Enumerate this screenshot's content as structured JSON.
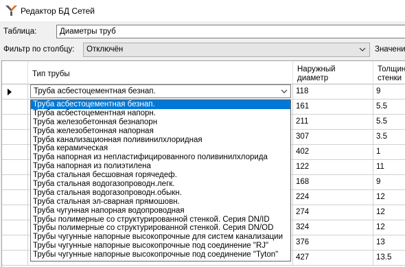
{
  "window": {
    "title": "Редактор БД Сетей"
  },
  "form": {
    "table_label": "Таблица:",
    "table_value": "Диаметры труб",
    "filter_label": "Фильтр по столбцу:",
    "filter_value": "Отключён",
    "value_label": "Значени"
  },
  "grid": {
    "headers": {
      "pipe_type": "Тип трубы",
      "outer_diameter": "Наружный диаметр",
      "wall_line1": "Толщин",
      "wall_line2": "стенки"
    },
    "current_row_combo": "Труба асбестоцементная безнап.",
    "rows": [
      {
        "diameter": "118",
        "wall": "9"
      },
      {
        "diameter": "161",
        "wall": "5.5"
      },
      {
        "diameter": "211",
        "wall": "5.5"
      },
      {
        "diameter": "307",
        "wall": "3.5"
      },
      {
        "diameter": "402",
        "wall": "1"
      },
      {
        "diameter": "122",
        "wall": "11"
      },
      {
        "diameter": "168",
        "wall": "9"
      },
      {
        "diameter": "224",
        "wall": "12"
      },
      {
        "diameter": "274",
        "wall": "12"
      },
      {
        "diameter": "324",
        "wall": "12"
      },
      {
        "diameter": "376",
        "wall": "13"
      },
      {
        "diameter": "427",
        "wall": "13.5"
      }
    ]
  },
  "dropdown": {
    "selected_index": 0,
    "options": [
      "Труба асбестоцементная безнап.",
      "Труба асбестоцементная напорн.",
      "Труба железобетонная безнапорн",
      "Труба железобетонная напорная",
      "Труба канализационная поливинилхлоридная",
      "Труба керамическая",
      "Труба напорная из непластифицированного поливинилхлорида",
      "Труба напорная из полиэтилена",
      "Труба стальная бесшовная горячедеф.",
      "Труба стальная водогазопроводн.легк.",
      "Труба стальная водогазопроводн.обыкн.",
      "Труба стальная эл-сварная прямошовн.",
      "Труба чугунная напорная водопроводная",
      "Трубы полимерные со структурированной стенкой. Серия DN/ID",
      "Трубы полимерные со структурированной стенкой. Серия DN/OD",
      "Трубы чугунные напорные высокопрочные для систем канализации",
      "Трубы чугунные напорные высокопрочные под соединение \"RJ\"",
      "Трубы чугунные напорные высокопрочные под соединение \"Tyton\""
    ]
  }
}
